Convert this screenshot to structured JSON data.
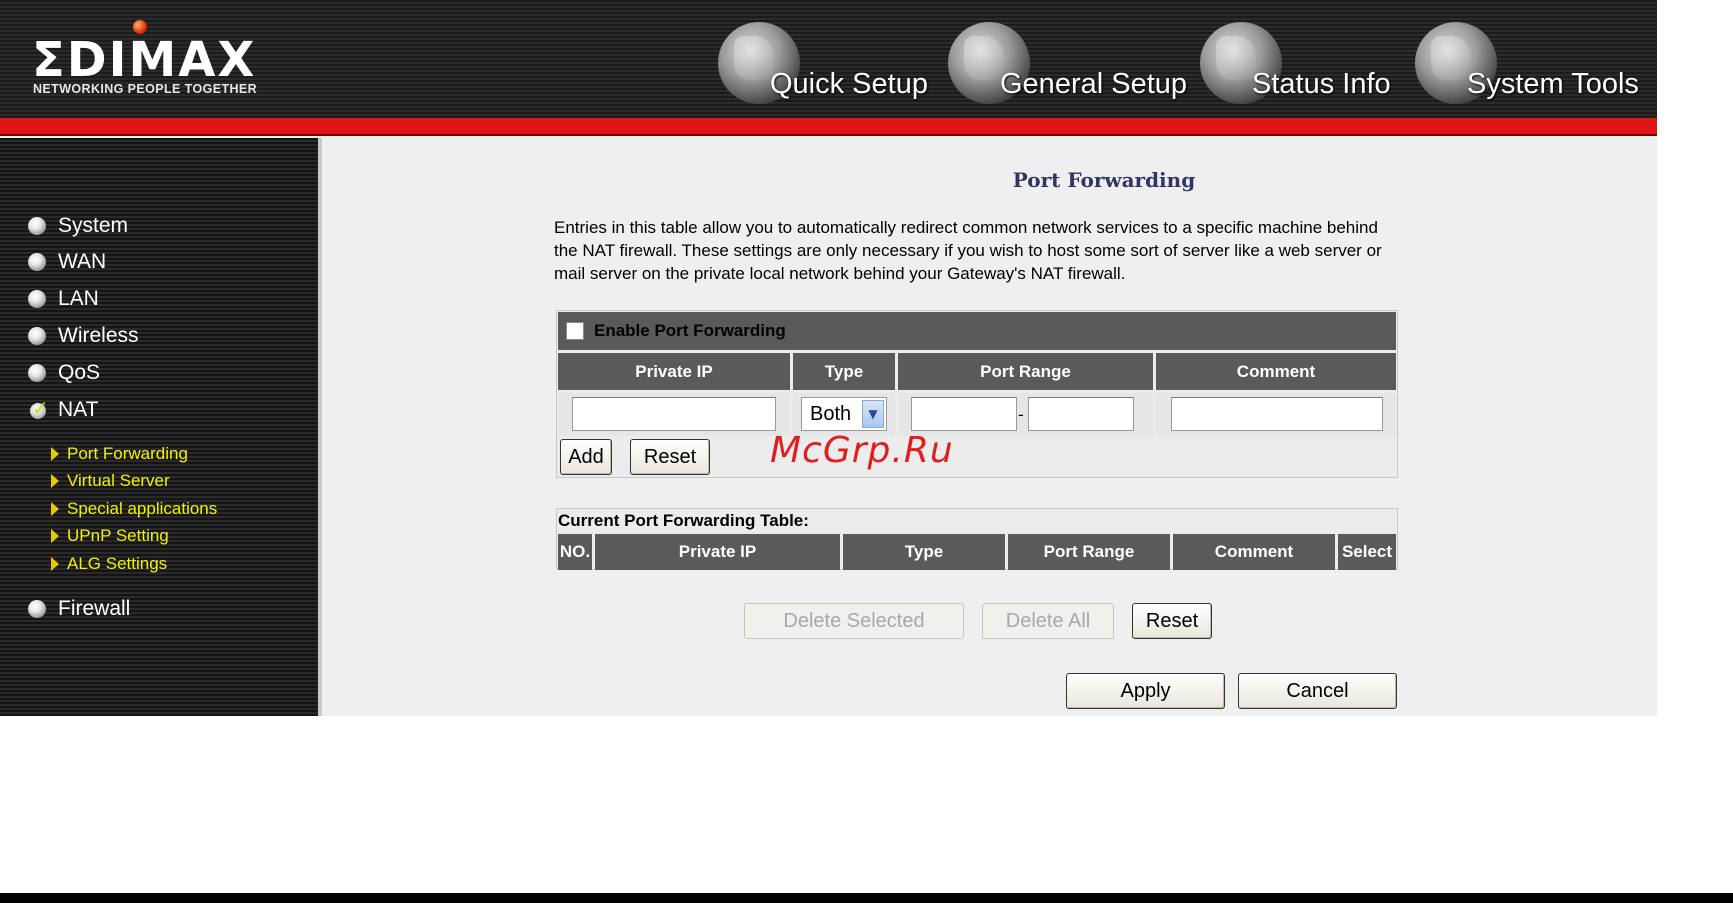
{
  "brand": {
    "logo_text": "ΣDIMAX",
    "tagline": "NETWORKING PEOPLE TOGETHER"
  },
  "top_nav": [
    {
      "label": "Quick Setup",
      "icon": "hand-icon"
    },
    {
      "label": "General Setup",
      "icon": "keyboard-icon"
    },
    {
      "label": "Status Info",
      "icon": "user-icon"
    },
    {
      "label": "System Tools",
      "icon": "tools-icon"
    }
  ],
  "sidebar": {
    "items": [
      {
        "label": "System"
      },
      {
        "label": "WAN"
      },
      {
        "label": "LAN"
      },
      {
        "label": "Wireless"
      },
      {
        "label": "QoS"
      },
      {
        "label": "NAT",
        "selected": true
      },
      {
        "label": "Firewall"
      }
    ],
    "sub_items": [
      {
        "label": "Port Forwarding"
      },
      {
        "label": "Virtual Server"
      },
      {
        "label": "Special applications"
      },
      {
        "label": "UPnP Setting"
      },
      {
        "label": "ALG Settings"
      }
    ]
  },
  "page": {
    "title": "Port Forwarding",
    "description": "Entries in this table allow you to automatically redirect common network services to a specific machine behind the NAT firewall. These settings are only necessary if you wish to host some sort of server like a web server or mail server on the private local network behind your Gateway's NAT firewall."
  },
  "form": {
    "enable_label": "Enable Port Forwarding",
    "enabled": false,
    "columns": [
      "Private IP",
      "Type",
      "Port Range",
      "Comment"
    ],
    "type_value": "Both",
    "port_separator": "-",
    "private_ip_value": "",
    "port_from_value": "",
    "port_to_value": "",
    "comment_value": "",
    "add_label": "Add",
    "reset_label": "Reset"
  },
  "watermark": "McGrp.Ru",
  "current_table": {
    "title": "Current Port Forwarding Table:",
    "columns": [
      "NO.",
      "Private IP",
      "Type",
      "Port Range",
      "Comment",
      "Select"
    ],
    "rows": []
  },
  "actions": {
    "delete_selected": "Delete Selected",
    "delete_all": "Delete All",
    "reset": "Reset",
    "apply": "Apply",
    "cancel": "Cancel"
  },
  "colors": {
    "accent_red": "#e01515",
    "header_gray": "#5a5a5a",
    "submenu_yellow": "#f2f200",
    "title_navy": "#333366"
  }
}
